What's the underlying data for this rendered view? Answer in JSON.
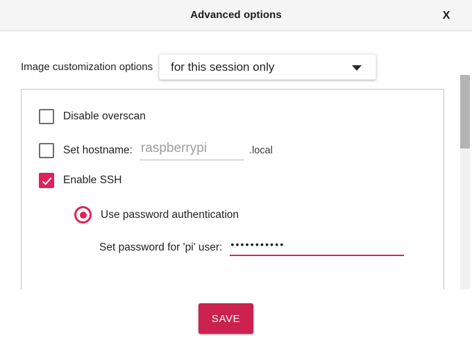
{
  "titlebar": {
    "title": "Advanced options",
    "close_label": "X"
  },
  "customization": {
    "label": "Image customization options",
    "selected": "for this session only",
    "options": [
      "for this session only"
    ],
    "arrow_icon": "chevron-down-icon"
  },
  "options": {
    "disable_overscan": {
      "label": "Disable overscan",
      "checked": false
    },
    "set_hostname": {
      "label": "Set hostname:",
      "checked": false,
      "placeholder": "raspberrypi",
      "value": "",
      "suffix": ".local"
    },
    "enable_ssh": {
      "label": "Enable SSH",
      "checked": true
    },
    "use_password_auth": {
      "label": "Use password authentication",
      "selected": true
    },
    "set_password": {
      "label": "Set password for 'pi' user:",
      "masked_value": "•••••••••••",
      "char_count": "11"
    }
  },
  "scrollbar": {
    "name": "vertical-scrollbar"
  },
  "footer": {
    "save_label": "SAVE"
  },
  "colors": {
    "accent": "#e0215a",
    "save_button": "#cc214f",
    "titlebar_bg": "#f5f5f5",
    "panel_border": "#c4c4c4",
    "scrollbar_thumb": "#b4b4b4"
  }
}
